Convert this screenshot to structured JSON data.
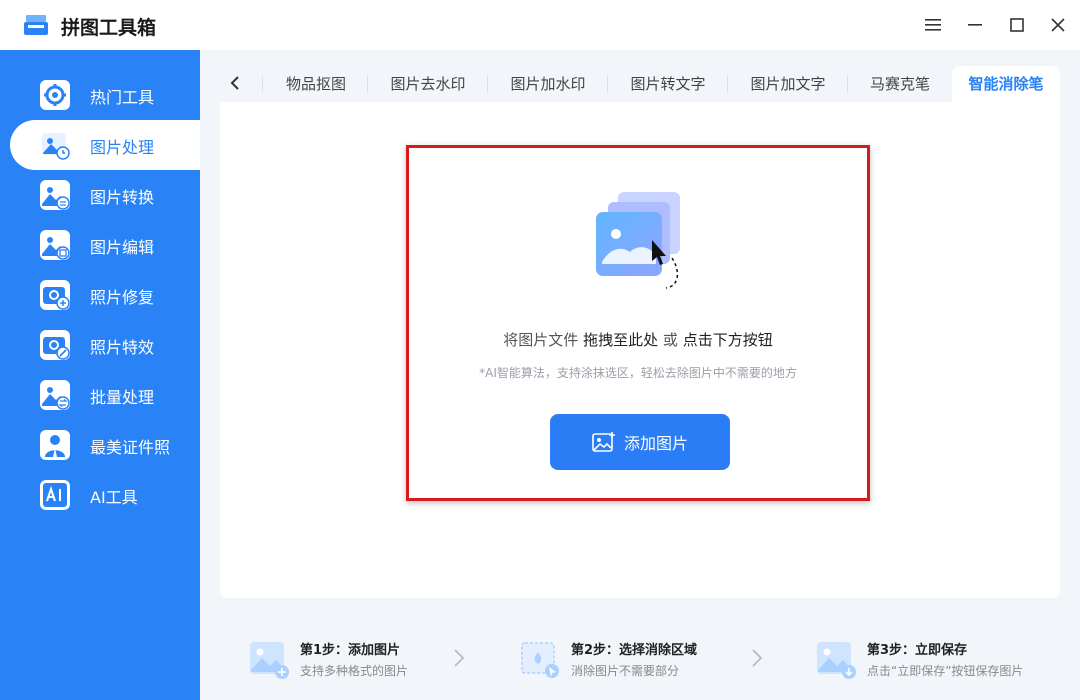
{
  "app": {
    "title": "拼图工具箱"
  },
  "colors": {
    "accent": "#2a83f6",
    "highlight_border": "#d71a1a"
  },
  "sidebar": {
    "items": [
      {
        "label": "热门工具",
        "icon": "wrench-gear-icon"
      },
      {
        "label": "图片处理",
        "icon": "image-clock-icon",
        "active": true
      },
      {
        "label": "图片转换",
        "icon": "image-swap-icon"
      },
      {
        "label": "图片编辑",
        "icon": "image-edit-icon"
      },
      {
        "label": "照片修复",
        "icon": "camera-plus-icon"
      },
      {
        "label": "照片特效",
        "icon": "camera-wand-icon"
      },
      {
        "label": "批量处理",
        "icon": "image-batch-icon"
      },
      {
        "label": "最美证件照",
        "icon": "id-photo-icon"
      },
      {
        "label": "AI工具",
        "icon": "ai-icon"
      }
    ]
  },
  "tabs": [
    {
      "label": "物品抠图"
    },
    {
      "label": "图片去水印"
    },
    {
      "label": "图片加水印"
    },
    {
      "label": "图片转文字"
    },
    {
      "label": "图片加文字"
    },
    {
      "label": "马赛克笔"
    },
    {
      "label": "智能消除笔",
      "active": true
    }
  ],
  "dropzone": {
    "text_prefix": "将图片文件",
    "text_drag": "拖拽至此处",
    "text_or": "或",
    "text_click": "点击下方按钮",
    "hint": "*AI智能算法，支持涂抹选区，轻松去除图片中不需要的地方",
    "button_label": "添加图片"
  },
  "steps": [
    {
      "title": "第1步：添加图片",
      "desc": "支持多种格式的图片"
    },
    {
      "title": "第2步：选择消除区域",
      "desc": "消除图片不需要部分"
    },
    {
      "title": "第3步：立即保存",
      "desc": "点击“立即保存”按钮保存图片"
    }
  ]
}
